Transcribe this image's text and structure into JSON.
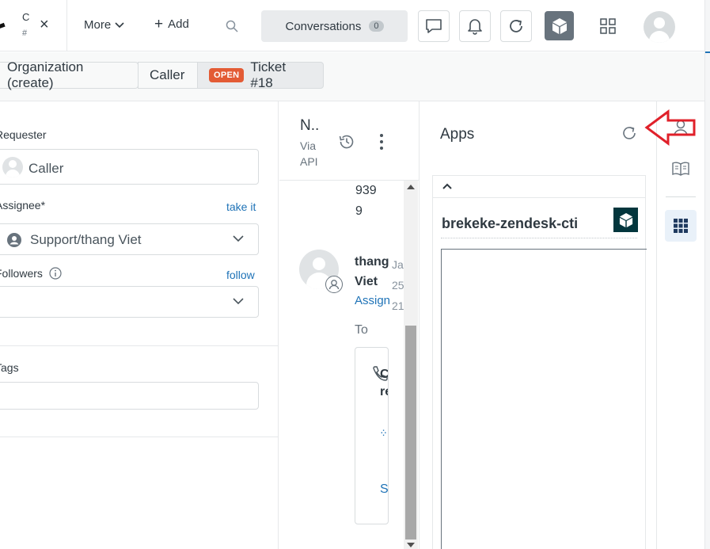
{
  "topbar": {
    "tab_title_fragment": "C",
    "tab_subtitle_fragment": "#",
    "more_label": "More",
    "add_label": "Add",
    "conversations_label": "Conversations",
    "conversations_count": "0"
  },
  "breadcrumbs": {
    "organization": "Organization (create)",
    "caller": "Caller",
    "status_badge": "OPEN",
    "ticket": "Ticket #18"
  },
  "properties": {
    "requester_label": "Requester",
    "requester_value": "Caller",
    "assignee_label": "Assignee*",
    "take_it_link": "take it",
    "assignee_value": "Support/thang Viet",
    "followers_label": "Followers",
    "follow_link": "follow",
    "tags_label": "Tags"
  },
  "conversation": {
    "title": "N..",
    "via": "Via API",
    "phone_number_lines": [
      "939",
      "9"
    ],
    "author_lines": [
      "thang",
      "Viet"
    ],
    "meta_lines": [
      "Ja",
      "25",
      "21"
    ],
    "assign_link": "Assign",
    "to_label": "To",
    "call_title_lines": [
      "Call",
      "reco"
    ],
    "spinner": "·:·",
    "show_link": "Sho"
  },
  "apps": {
    "title": "Apps",
    "app_name": "brekeke-zendesk-cti"
  },
  "colors": {
    "accent_blue": "#1f73b7",
    "open_badge": "#e35b35",
    "annotation_red": "#e0202a",
    "app_logo_bg": "#03363d"
  },
  "icons": {
    "search": "search-icon",
    "refresh": "refresh-icon",
    "history": "history-icon",
    "apps": "cube-icon"
  }
}
